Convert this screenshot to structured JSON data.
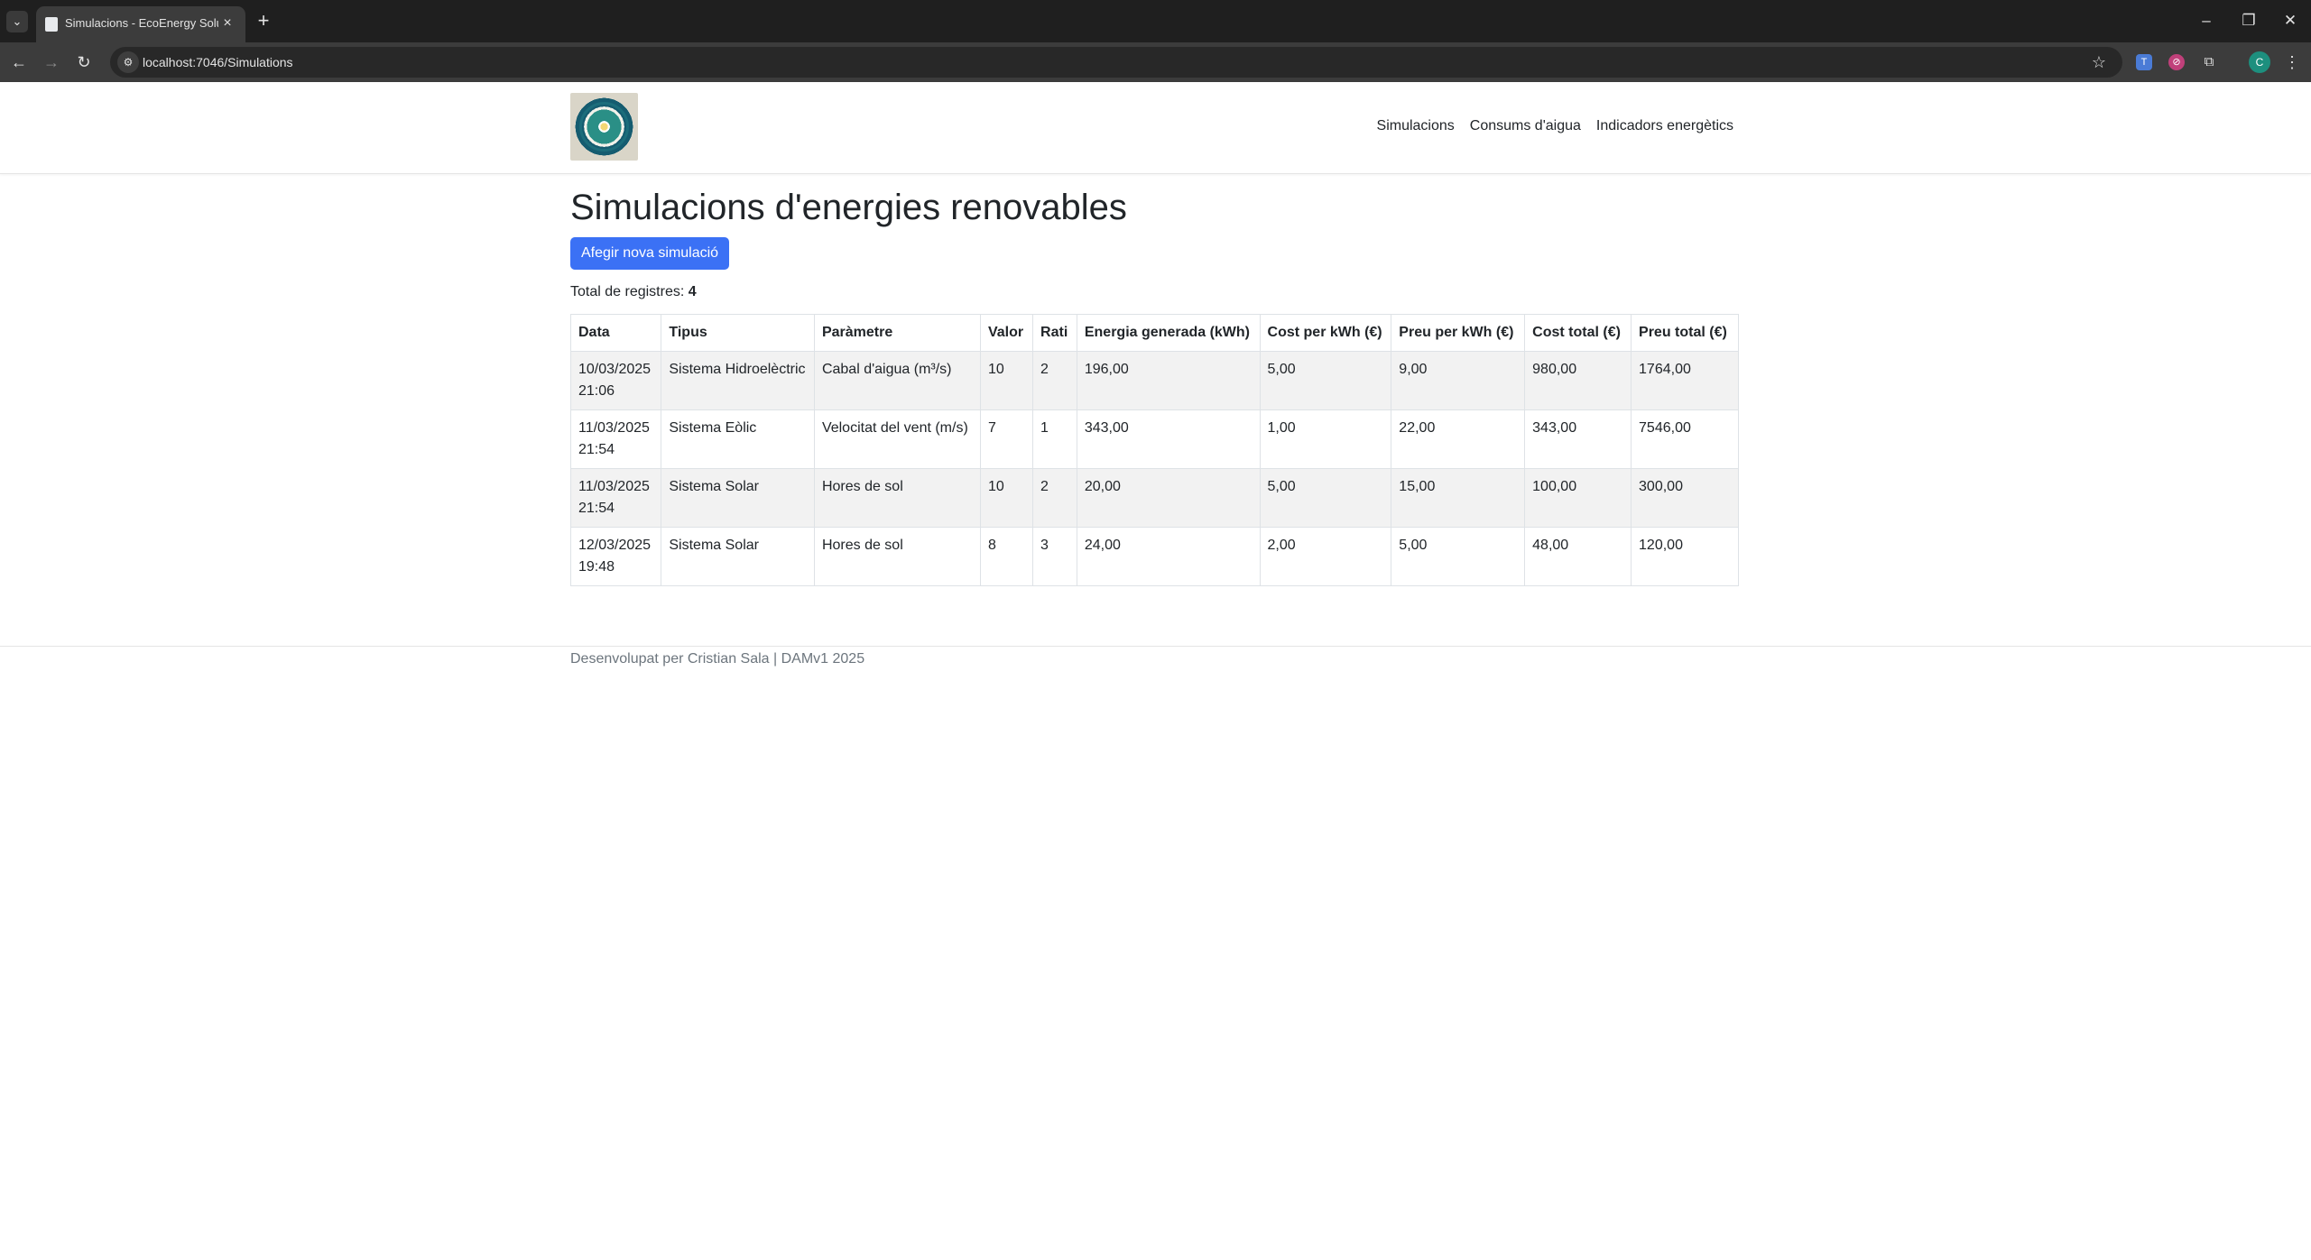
{
  "browser": {
    "tab_title": "Simulacions - EcoEnergy Soluti",
    "url": "localhost:7046/Simulations"
  },
  "navbar": {
    "links": [
      "Simulacions",
      "Consums d'aigua",
      "Indicadors energètics"
    ]
  },
  "main": {
    "title": "Simulacions d'energies renovables",
    "add_button": "Afegir nova simulació",
    "total_label": "Total de registres:",
    "total_count": "4"
  },
  "table": {
    "headers": [
      "Data",
      "Tipus",
      "Paràmetre",
      "Valor",
      "Rati",
      "Energia generada (kWh)",
      "Cost per kWh (€)",
      "Preu per kWh (€)",
      "Cost total (€)",
      "Preu total (€)"
    ],
    "rows": [
      [
        "10/03/2025 21:06",
        "Sistema Hidroelèctric",
        "Cabal d'aigua (m³/s)",
        "10",
        "2",
        "196,00",
        "5,00",
        "9,00",
        "980,00",
        "1764,00"
      ],
      [
        "11/03/2025 21:54",
        "Sistema Eòlic",
        "Velocitat del vent (m/s)",
        "7",
        "1",
        "343,00",
        "1,00",
        "22,00",
        "343,00",
        "7546,00"
      ],
      [
        "11/03/2025 21:54",
        "Sistema Solar",
        "Hores de sol",
        "10",
        "2",
        "20,00",
        "5,00",
        "15,00",
        "100,00",
        "300,00"
      ],
      [
        "12/03/2025 19:48",
        "Sistema Solar",
        "Hores de sol",
        "8",
        "3",
        "24,00",
        "2,00",
        "5,00",
        "48,00",
        "120,00"
      ]
    ]
  },
  "footer": {
    "text": "Desenvolupat per Cristian Sala | DAMv1 2025"
  }
}
